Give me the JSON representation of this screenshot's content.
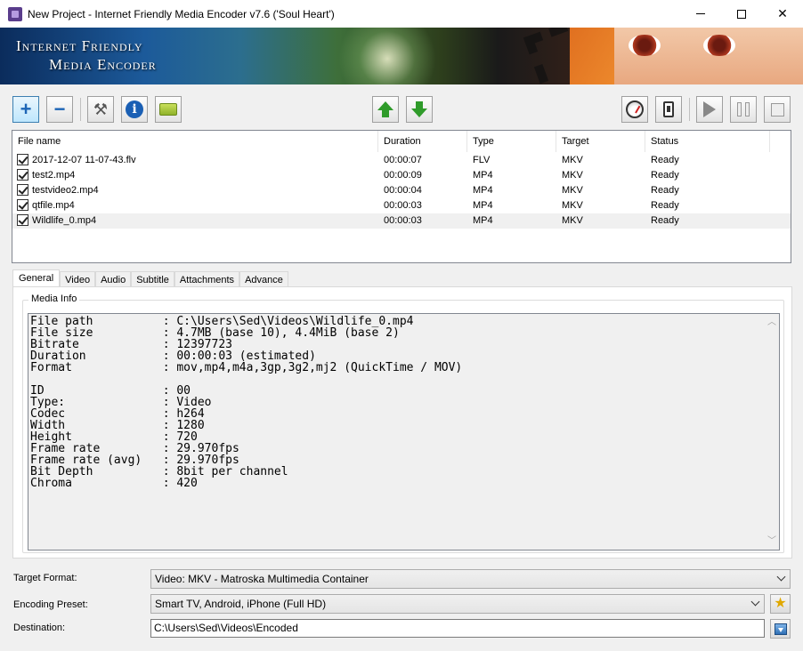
{
  "window": {
    "title": "New Project - Internet Friendly Media Encoder v7.6 ('Soul Heart')",
    "minimize": "—",
    "maximize": "☐",
    "close": "✕"
  },
  "banner": {
    "line1": "Internet Friendly",
    "line2": "Media Encoder"
  },
  "toolbar": {
    "add_icon": "+",
    "remove_icon": "−",
    "info_icon": "i",
    "settings_icon": "⚒"
  },
  "file_list": {
    "columns": [
      "File name",
      "Duration",
      "Type",
      "Target",
      "Status"
    ],
    "rows": [
      {
        "name": "2017-12-07 11-07-43.flv",
        "duration": "00:00:07",
        "type": "FLV",
        "target": "MKV",
        "status": "Ready",
        "checked": true
      },
      {
        "name": "test2.mp4",
        "duration": "00:00:09",
        "type": "MP4",
        "target": "MKV",
        "status": "Ready",
        "checked": true
      },
      {
        "name": "testvideo2.mp4",
        "duration": "00:00:04",
        "type": "MP4",
        "target": "MKV",
        "status": "Ready",
        "checked": true
      },
      {
        "name": "qtfile.mp4",
        "duration": "00:00:03",
        "type": "MP4",
        "target": "MKV",
        "status": "Ready",
        "checked": true
      },
      {
        "name": "Wildlife_0.mp4",
        "duration": "00:00:03",
        "type": "MP4",
        "target": "MKV",
        "status": "Ready",
        "checked": true
      }
    ]
  },
  "tabs": [
    "General",
    "Video",
    "Audio",
    "Subtitle",
    "Attachments",
    "Advance"
  ],
  "media_info": {
    "group_label": "Media Info",
    "lines": [
      "File path          : C:\\Users\\Sed\\Videos\\Wildlife_0.mp4",
      "File size          : 4.7MB (base 10), 4.4MiB (base 2)",
      "Bitrate            : 12397723",
      "Duration           : 00:00:03 (estimated)",
      "Format             : mov,mp4,m4a,3gp,3g2,mj2 (QuickTime / MOV)",
      "",
      "ID                 : 00",
      "Type:              : Video",
      "Codec              : h264",
      "Width              : 1280",
      "Height             : 720",
      "Frame rate         : 29.970fps",
      "Frame rate (avg)   : 29.970fps",
      "Bit Depth          : 8bit per channel",
      "Chroma             : 420"
    ]
  },
  "form": {
    "target_format_label": "Target Format:",
    "target_format_value": "Video: MKV - Matroska Multimedia Container",
    "encoding_preset_label": "Encoding Preset:",
    "encoding_preset_value": "Smart TV, Android, iPhone (Full HD)",
    "destination_label": "Destination:",
    "destination_value": "C:\\Users\\Sed\\Videos\\Encoded"
  }
}
